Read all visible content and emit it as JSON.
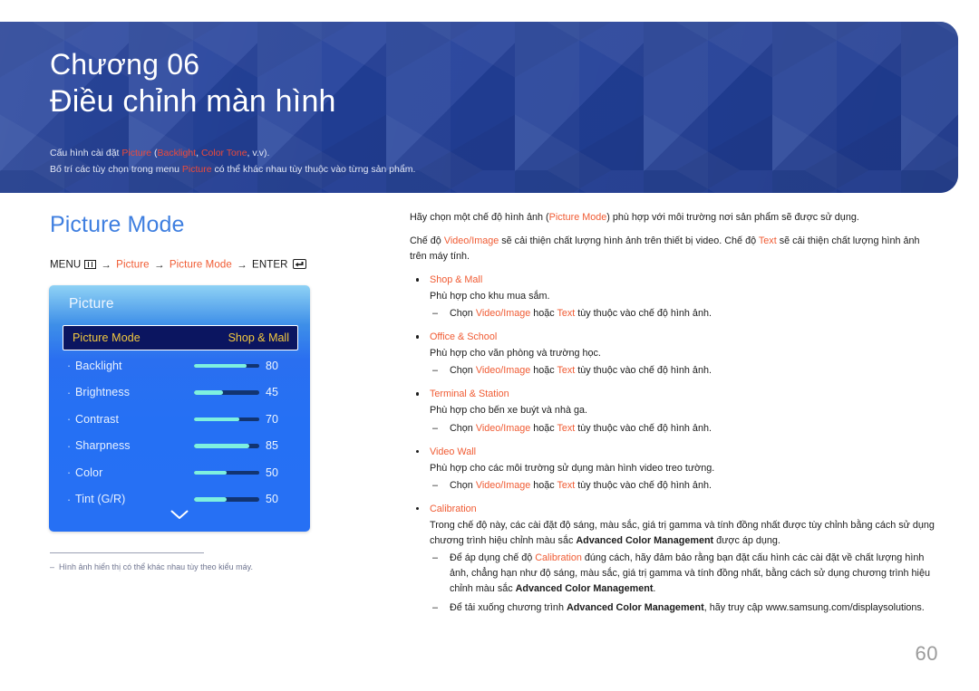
{
  "header": {
    "chapter_number": "Chương 06",
    "chapter_title": "Điều chỉnh màn hình",
    "sub_line1_pre": "Cấu hình cài đặt ",
    "sub_line1_hl1": "Picture",
    "sub_line1_mid": " (",
    "sub_line1_hl2": "Backlight",
    "sub_line1_mid2": ", ",
    "sub_line1_hl3": "Color Tone",
    "sub_line1_post": ", v.v).",
    "sub_line2_pre": "Bố trí các tùy chọn trong menu ",
    "sub_line2_hl": "Picture",
    "sub_line2_post": " có thể khác nhau tùy thuộc vào từng sản phẩm."
  },
  "section": {
    "title": "Picture Mode",
    "menu_path": {
      "menu_label": "MENU",
      "arrow": "→",
      "step1": "Picture",
      "step2": "Picture Mode",
      "enter_label": "ENTER"
    }
  },
  "osd": {
    "title": "Picture",
    "selected_row": {
      "label": "Picture Mode",
      "value": "Shop & Mall"
    },
    "rows": [
      {
        "label": "Backlight",
        "value": "80",
        "fill": 80
      },
      {
        "label": "Brightness",
        "value": "45",
        "fill": 45
      },
      {
        "label": "Contrast",
        "value": "70",
        "fill": 70
      },
      {
        "label": "Sharpness",
        "value": "85",
        "fill": 85
      },
      {
        "label": "Color",
        "value": "50",
        "fill": 50
      },
      {
        "label": "Tint (G/R)",
        "value": "50",
        "fill": 50
      }
    ],
    "scroll_icon": "chevron-down-icon"
  },
  "footnote": {
    "dash": "‒",
    "text": "Hình ảnh hiển thị có thể khác nhau tùy theo kiểu máy."
  },
  "body": {
    "intro1_pre": "Hãy chọn một chế độ hình ảnh (",
    "intro1_hl": "Picture Mode",
    "intro1_post": ") phù hợp với môi trường nơi sản phẩm sẽ được sử dụng.",
    "intro2_pre": "Chế độ ",
    "intro2_hl1": "Video/Image",
    "intro2_mid": " sẽ cải thiện chất lượng hình ảnh trên thiết bị video. Chế độ ",
    "intro2_hl2": "Text",
    "intro2_post": " sẽ cải thiện chất lượng hình ảnh trên máy tính.",
    "sub_choose_pre": "Chọn ",
    "sub_choose_hl1": "Video/Image",
    "sub_choose_mid": " hoặc ",
    "sub_choose_hl2": "Text",
    "sub_choose_post": " tùy thuộc vào chế độ hình ảnh.",
    "items": [
      {
        "title": "Shop & Mall",
        "desc": "Phù hợp cho khu mua sắm."
      },
      {
        "title": "Office & School",
        "desc": "Phù hợp cho văn phòng và trường học."
      },
      {
        "title": "Terminal & Station",
        "desc": "Phù hợp cho bến xe buýt và nhà ga."
      },
      {
        "title": "Video Wall",
        "desc": "Phù hợp cho các môi trường sử dụng màn hình video treo tường."
      }
    ],
    "calibration": {
      "title": "Calibration",
      "desc_pre": "Trong chế độ này, các cài đặt độ sáng, màu sắc, giá trị gamma và tính đồng nhất được tùy chỉnh bằng cách sử dụng chương trình hiệu chỉnh màu sắc ",
      "desc_bold": "Advanced Color Management",
      "desc_post": " được áp dụng.",
      "note1_pre": "Để áp dụng chế độ ",
      "note1_hl": "Calibration",
      "note1_mid": " đúng cách, hãy đảm bảo rằng bạn đặt cấu hình các cài đặt về chất lượng hình ảnh, chẳng hạn như độ sáng, màu sắc, giá trị gamma và tính đồng nhất, bằng cách sử dụng chương trình hiệu chỉnh màu sắc ",
      "note1_bold": "Advanced Color Management",
      "note1_post": ".",
      "note2_pre": "Để tải xuống chương trình ",
      "note2_bold": "Advanced Color Management",
      "note2_post": ", hãy truy cập www.samsung.com/displaysolutions."
    }
  },
  "page_number": "60"
}
